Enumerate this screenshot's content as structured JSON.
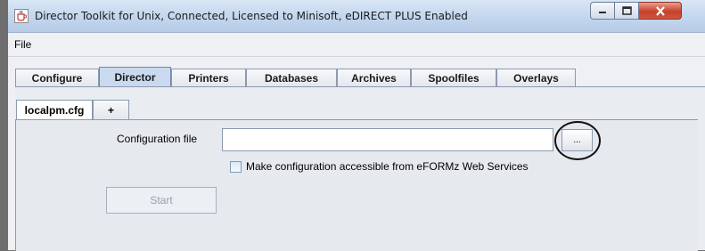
{
  "window": {
    "title": "Director Toolkit for Unix, Connected, Licensed to Minisoft, eDIRECT PLUS Enabled"
  },
  "menu": {
    "file": "File"
  },
  "tabs": [
    {
      "label": "Configure"
    },
    {
      "label": "Director"
    },
    {
      "label": "Printers"
    },
    {
      "label": "Databases"
    },
    {
      "label": "Archives"
    },
    {
      "label": "Spoolfiles"
    },
    {
      "label": "Overlays"
    }
  ],
  "active_tab": "Director",
  "subtabs": [
    {
      "label": "localpm.cfg"
    },
    {
      "label": "+"
    }
  ],
  "form": {
    "config_file_label": "Configuration file",
    "config_file_value": "",
    "browse_label": "...",
    "checkbox_label": "Make configuration accessible from eFORMz Web Services",
    "checkbox_checked": false,
    "start_label": "Start"
  },
  "colors": {
    "active_tab": "#c9d9ef",
    "close_button": "#c7402a"
  }
}
